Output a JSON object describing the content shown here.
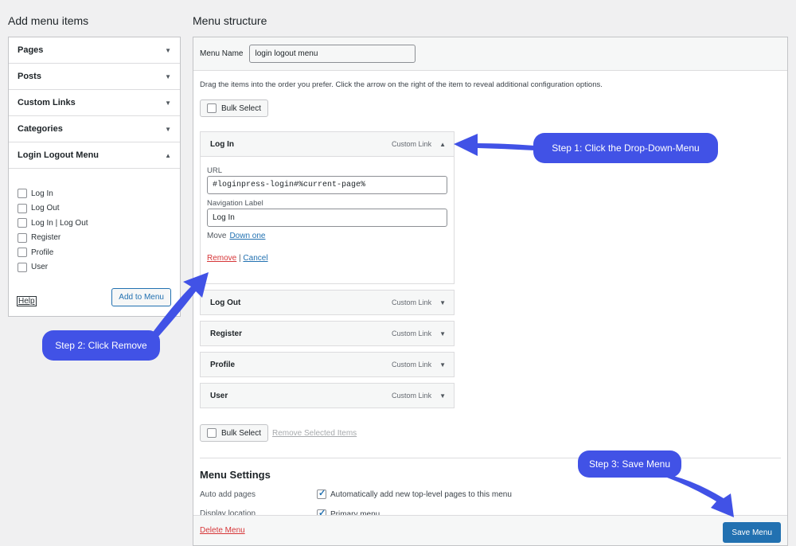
{
  "left": {
    "title": "Add menu items",
    "sections": [
      {
        "label": "Pages",
        "arrow": "▼"
      },
      {
        "label": "Posts",
        "arrow": "▼"
      },
      {
        "label": "Custom Links",
        "arrow": "▼"
      },
      {
        "label": "Categories",
        "arrow": "▼"
      },
      {
        "label": "Login Logout Menu",
        "arrow": "▲"
      }
    ],
    "login_items": [
      "Log In",
      "Log Out",
      "Log In | Log Out",
      "Register",
      "Profile",
      "User"
    ],
    "help_label": "Help",
    "add_button": "Add to Menu"
  },
  "right": {
    "title": "Menu structure",
    "menu_name_label": "Menu Name",
    "menu_name_value": "login logout menu",
    "instructions": "Drag the items into the order you prefer. Click the arrow on the right of the item to reveal additional configuration options.",
    "bulk_select": "Bulk Select",
    "remove_selected": "Remove Selected Items",
    "items": [
      {
        "title": "Log In",
        "type": "Custom Link",
        "arrow": "▲"
      },
      {
        "title": "Log Out",
        "type": "Custom Link",
        "arrow": "▼"
      },
      {
        "title": "Register",
        "type": "Custom Link",
        "arrow": "▼"
      },
      {
        "title": "Profile",
        "type": "Custom Link",
        "arrow": "▼"
      },
      {
        "title": "User",
        "type": "Custom Link",
        "arrow": "▼"
      }
    ],
    "expanded": {
      "url_label": "URL",
      "url_value": "#loginpress-login#%current-page%",
      "nav_label": "Navigation Label",
      "nav_value": "Log In",
      "move_label": "Move",
      "move_link": "Down one",
      "remove": "Remove",
      "separator": "|",
      "cancel": "Cancel"
    },
    "settings": {
      "title": "Menu Settings",
      "auto_add_label": "Auto add pages",
      "auto_add_value": "Automatically add new top-level pages to this menu",
      "display_label": "Display location",
      "display_value": "Primary menu"
    },
    "delete_menu": "Delete Menu",
    "save_menu": "Save Menu"
  },
  "callouts": {
    "step1": "Step 1: Click the Drop-Down-Menu",
    "step2": "Step 2: Click Remove",
    "step3": "Step 3: Save Menu"
  },
  "colors": {
    "callout": "#4152e6",
    "primary": "#2271b1",
    "danger": "#d63638"
  }
}
